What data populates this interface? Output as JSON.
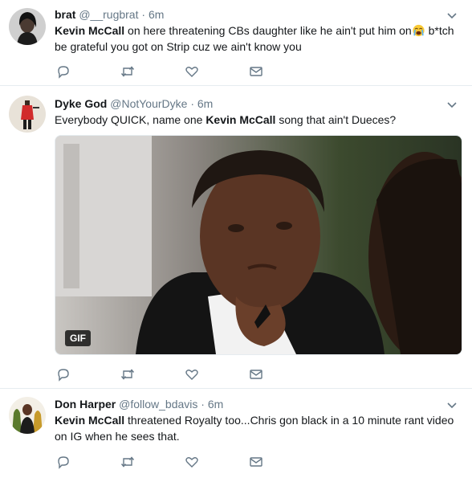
{
  "tweets": [
    {
      "name": "brat",
      "handle": "@__rugbrat",
      "time": "6m",
      "mention": "Kevin McCall",
      "text_before": "",
      "text_after_mention": " on here threatening CBs daughter like he ain't put him on",
      "text_after_emoji": " b*tch be grateful you got on Strip cuz we ain't know you",
      "emoji": "loudly-crying-face"
    },
    {
      "name": "Dyke God",
      "handle": "@NotYourDyke",
      "time": "6m",
      "text_before": "Everybody QUICK, name one ",
      "mention": "Kevin McCall",
      "text_after_mention": " song that ain't Dueces?",
      "media_badge": "GIF"
    },
    {
      "name": "Don Harper",
      "handle": "@follow_bdavis",
      "time": "6m",
      "text_before": "",
      "mention": "Kevin McCall",
      "text_after_mention": " threatened Royalty too...Chris gon black in a 10 minute rant video on IG when he sees that."
    }
  ],
  "separator": "·",
  "actions": [
    "reply-icon",
    "retweet-icon",
    "like-icon",
    "direct-message-icon"
  ],
  "colors": {
    "name": "#14171a",
    "meta": "#657786",
    "icon": "#657786",
    "divider": "#e6ecf0"
  }
}
